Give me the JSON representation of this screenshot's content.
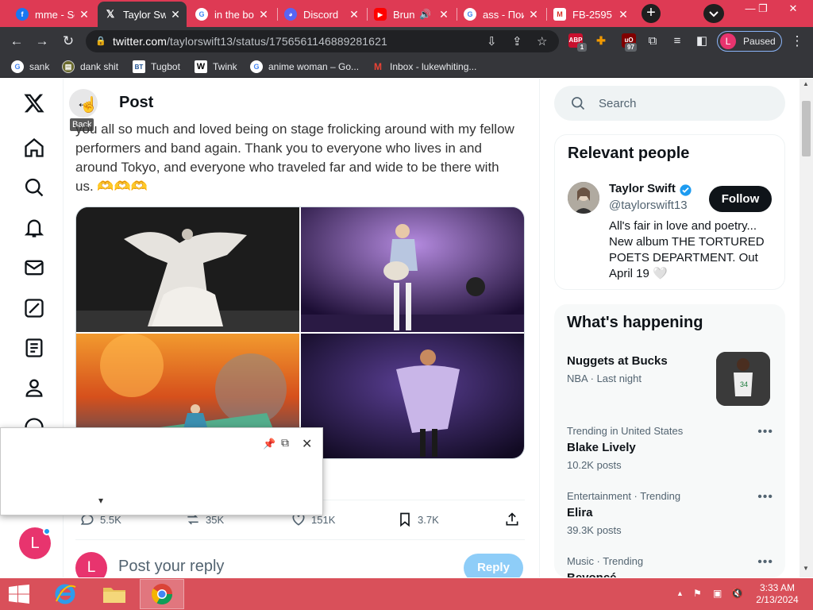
{
  "browser": {
    "tabs": [
      {
        "title": "mme - Se",
        "icon": "facebook-icon",
        "color": "#1877f2",
        "glyph": "f"
      },
      {
        "title": "Taylor Sw",
        "icon": "x-icon",
        "color": "#000000",
        "glyph": "𝕏"
      },
      {
        "title": "in the bo",
        "icon": "google-icon",
        "color": "#ffffff",
        "glyph": "G"
      },
      {
        "title": "Discord",
        "icon": "discord-icon",
        "color": "#5865f2",
        "glyph": "◕"
      },
      {
        "title": "Brun",
        "icon": "youtube-icon",
        "color": "#ff0000",
        "glyph": "▶"
      },
      {
        "title": "ass - Пои",
        "icon": "google-icon",
        "color": "#ffffff",
        "glyph": "G"
      },
      {
        "title": "FB-2595",
        "icon": "gmail-icon",
        "color": "#ffffff",
        "glyph": "M"
      }
    ],
    "new_tab": "+",
    "url_host": "twitter.com",
    "url_path": "/taylorswift13/status/1756561146889281621",
    "profile_initial": "L",
    "profile_status": "Paused",
    "ext_badges": {
      "abp": "ABP",
      "abp_count": "1",
      "ublock_count": "97"
    },
    "bookmarks": [
      {
        "label": "sank",
        "icon": "google-icon"
      },
      {
        "label": "dank shit",
        "icon": "folder-icon"
      },
      {
        "label": "Tugbot",
        "icon": "bt-icon"
      },
      {
        "label": "Twink",
        "icon": "w-icon"
      },
      {
        "label": "anime woman – Go...",
        "icon": "google-icon"
      },
      {
        "label": "Inbox - lukewhiting...",
        "icon": "gmail-icon"
      }
    ]
  },
  "page": {
    "header_title": "Post",
    "back_tooltip": "Back",
    "tweet_text": "you all so much and loved being on stage frolicking around with my fellow performers and band again. Thank you to everyone who lives in and around Tokyo, and everyone who traveled far and wide to be there with us. 🫶🫶🫶",
    "actions": {
      "reply_count": "5.5K",
      "repost_count": "35K",
      "like_count": "151K",
      "bookmark_count": "3.7K"
    },
    "reply_placeholder": "Post your reply",
    "reply_button": "Reply",
    "user_initial": "L",
    "search_placeholder": "Search",
    "relevant": {
      "heading": "Relevant people",
      "name": "Taylor Swift",
      "handle": "@taylorswift13",
      "bio": "All's fair in love and poetry... New album THE TORTURED POETS DEPARTMENT. Out April 19 🤍",
      "follow_label": "Follow"
    },
    "happening": {
      "heading": "What's happening",
      "trends": [
        {
          "context": "",
          "name": "Nuggets at Bucks",
          "count": "NBA · Last night"
        },
        {
          "context": "Trending in United States",
          "name": "Blake Lively",
          "count": "10.2K posts"
        },
        {
          "context": "Entertainment · Trending",
          "name": "Elira",
          "count": "39.3K posts"
        },
        {
          "context": "Music · Trending",
          "name": "Beyoncé",
          "count": ""
        }
      ]
    }
  },
  "taskbar": {
    "time": "3:33 AM",
    "date": "2/13/2024"
  }
}
